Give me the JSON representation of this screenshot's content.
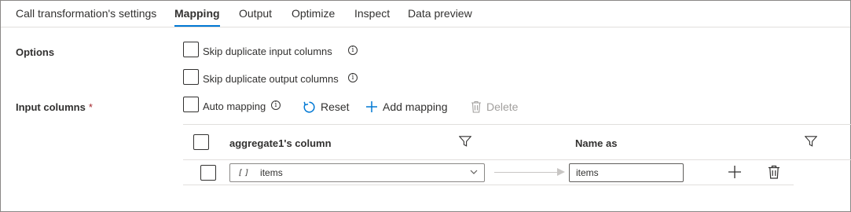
{
  "tabs": [
    {
      "label": "Call transformation's settings"
    },
    {
      "label": "Mapping"
    },
    {
      "label": "Output"
    },
    {
      "label": "Optimize"
    },
    {
      "label": "Inspect"
    },
    {
      "label": "Data preview"
    }
  ],
  "active_tab": "Mapping",
  "options": {
    "label": "Options",
    "skip_input": "Skip duplicate input columns",
    "skip_output": "Skip duplicate output columns"
  },
  "input_columns": {
    "label": "Input columns",
    "required_marker": "*",
    "auto_mapping": "Auto mapping",
    "reset": "Reset",
    "add_mapping": "Add mapping",
    "delete": "Delete"
  },
  "grid": {
    "source_header": "aggregate1's column",
    "target_header": "Name as",
    "rows": [
      {
        "type_icon": "[]",
        "source": "items",
        "target": "items"
      }
    ]
  },
  "icons": {
    "info": "info-icon",
    "reset": "reset-icon",
    "add": "plus-icon",
    "delete": "trash-icon",
    "filter": "filter-icon",
    "chevron": "chevron-down-icon",
    "array": "array-type-icon"
  },
  "colors": {
    "accent": "#0078d4",
    "required": "#a4262c",
    "disabled": "#a19f9d"
  }
}
